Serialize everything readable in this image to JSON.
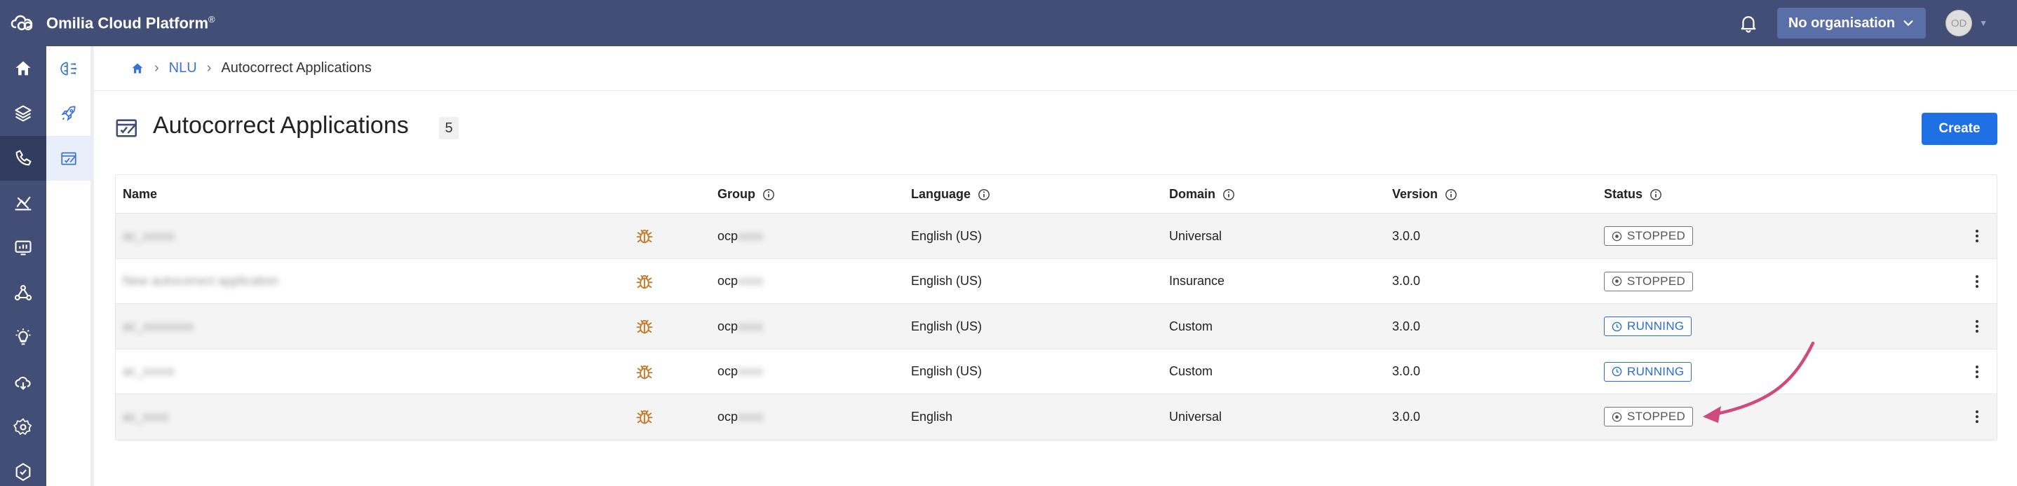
{
  "app": {
    "title": "Omilia Cloud Platform",
    "trademark": "®"
  },
  "topbar": {
    "org_label": "No organisation",
    "avatar_initials": "OD"
  },
  "breadcrumb": {
    "items": [
      "NLU",
      "Autocorrect Applications"
    ]
  },
  "page": {
    "title": "Autocorrect Applications",
    "count": "5",
    "create_label": "Create"
  },
  "table": {
    "columns": [
      "Name",
      "",
      "Group",
      "Language",
      "Domain",
      "Version",
      "Status"
    ],
    "rows": [
      {
        "name": "ac_xxxxx",
        "group_prefix": "ocp",
        "group_rest": "xxxx",
        "language": "English (US)",
        "domain": "Universal",
        "version": "3.0.0",
        "status": "STOPPED"
      },
      {
        "name": "New autocorrect application",
        "group_prefix": "ocp",
        "group_rest": "xxxx",
        "language": "English (US)",
        "domain": "Insurance",
        "version": "3.0.0",
        "status": "STOPPED"
      },
      {
        "name": "ac_xxxxxxxx",
        "group_prefix": "ocp",
        "group_rest": "xxxx",
        "language": "English (US)",
        "domain": "Custom",
        "version": "3.0.0",
        "status": "RUNNING"
      },
      {
        "name": "ac_xxxxx",
        "group_prefix": "ocp",
        "group_rest": "xxxx",
        "language": "English (US)",
        "domain": "Custom",
        "version": "3.0.0",
        "status": "RUNNING"
      },
      {
        "name": "ac_xxxx",
        "group_prefix": "ocp",
        "group_rest": "xxxx",
        "language": "English",
        "domain": "Universal",
        "version": "3.0.0",
        "status": "STOPPED"
      }
    ]
  },
  "colors": {
    "topbar": "#424e76",
    "accent": "#1f6fe5",
    "running": "#2b6cd8",
    "stopped": "#555555",
    "annotation": "#d04a7c",
    "bug": "#c47a2c"
  },
  "icons": {
    "leftnav": [
      "home-icon",
      "layers-icon",
      "phone-icon",
      "analytics-icon",
      "monitor-icon",
      "network-icon",
      "lightbulb-icon",
      "cloud-icon",
      "settings-icon",
      "shield-icon"
    ],
    "subnav": [
      "nlu-models-icon",
      "rocket-icon",
      "autocorrect-icon"
    ]
  }
}
